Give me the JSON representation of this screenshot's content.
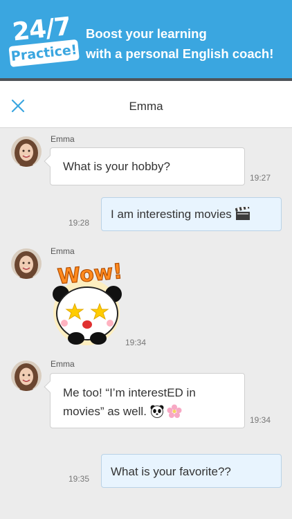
{
  "banner": {
    "badge_line1": "24/7",
    "badge_line2": "Practice!",
    "tagline_line1": "Boost your learning",
    "tagline_line2": "with a personal English coach!"
  },
  "nav": {
    "title": "Emma",
    "close_icon": "close-icon"
  },
  "messages": [
    {
      "sender": "Emma",
      "text": "What is your hobby?",
      "time": "19:27",
      "direction": "incoming"
    },
    {
      "text": "I am interesting movies",
      "emoji": "clapperboard-emoji",
      "time": "19:28",
      "direction": "outgoing"
    },
    {
      "sender": "Emma",
      "sticker": "panda-wow-sticker",
      "sticker_text": "Wow!",
      "time": "19:34",
      "direction": "incoming"
    },
    {
      "sender": "Emma",
      "text_line1": "Me too! “I’m interestED in",
      "text_line2": "movies” as well.",
      "emojis": [
        "panda-emoji",
        "cherry-blossom-emoji"
      ],
      "time": "19:34",
      "direction": "incoming"
    },
    {
      "text": "What is your favorite??",
      "time": "19:35",
      "direction": "outgoing"
    }
  ],
  "colors": {
    "banner": "#3aa6e0",
    "outgoing_bubble": "#e8f4fe",
    "incoming_bubble": "#ffffff",
    "chat_background": "#ececec",
    "accent": "#3aa6e0"
  }
}
